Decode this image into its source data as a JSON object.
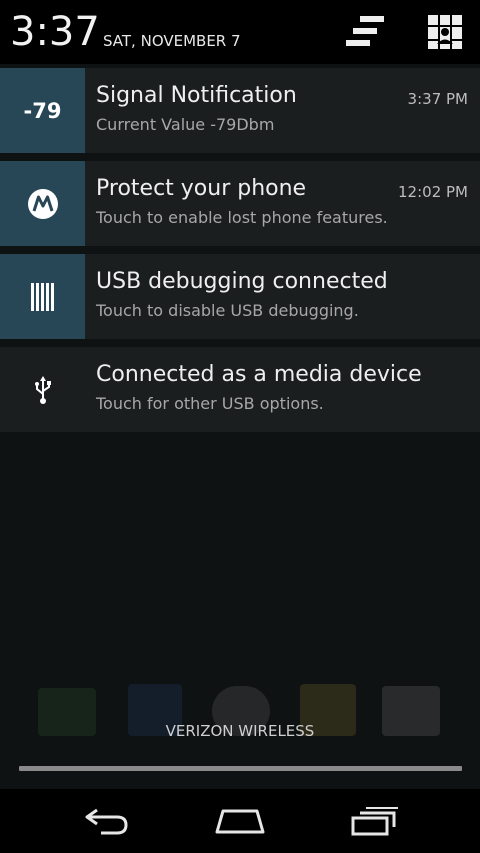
{
  "header": {
    "time": "3:37",
    "date": "SAT, NOVEMBER 7",
    "clear_icon": "clear-all-icon",
    "settings_icon": "quick-settings-icon"
  },
  "notifications": [
    {
      "icon_text": "-79",
      "title": "Signal Notification",
      "text": "Current Value -79Dbm",
      "time": "3:37 PM"
    },
    {
      "icon": "motorola-logo-icon",
      "title": "Protect your phone",
      "text": "Touch to enable lost phone features.",
      "time": "12:02 PM"
    },
    {
      "icon": "usb-debugging-icon",
      "title": "USB debugging connected",
      "text": "Touch to disable USB debugging."
    },
    {
      "icon": "usb-icon",
      "title": "Connected as a media device",
      "text": "Touch for other USB options."
    }
  ],
  "footer": {
    "carrier": "VERIZON WIRELESS"
  },
  "navbar": {
    "back_icon": "back-icon",
    "home_icon": "home-icon",
    "recent_icon": "recent-apps-icon"
  },
  "colors": {
    "accent_icon_bg": "#274656",
    "notification_bg": "#1b1e1f",
    "screen_bg": "#0f1213"
  }
}
